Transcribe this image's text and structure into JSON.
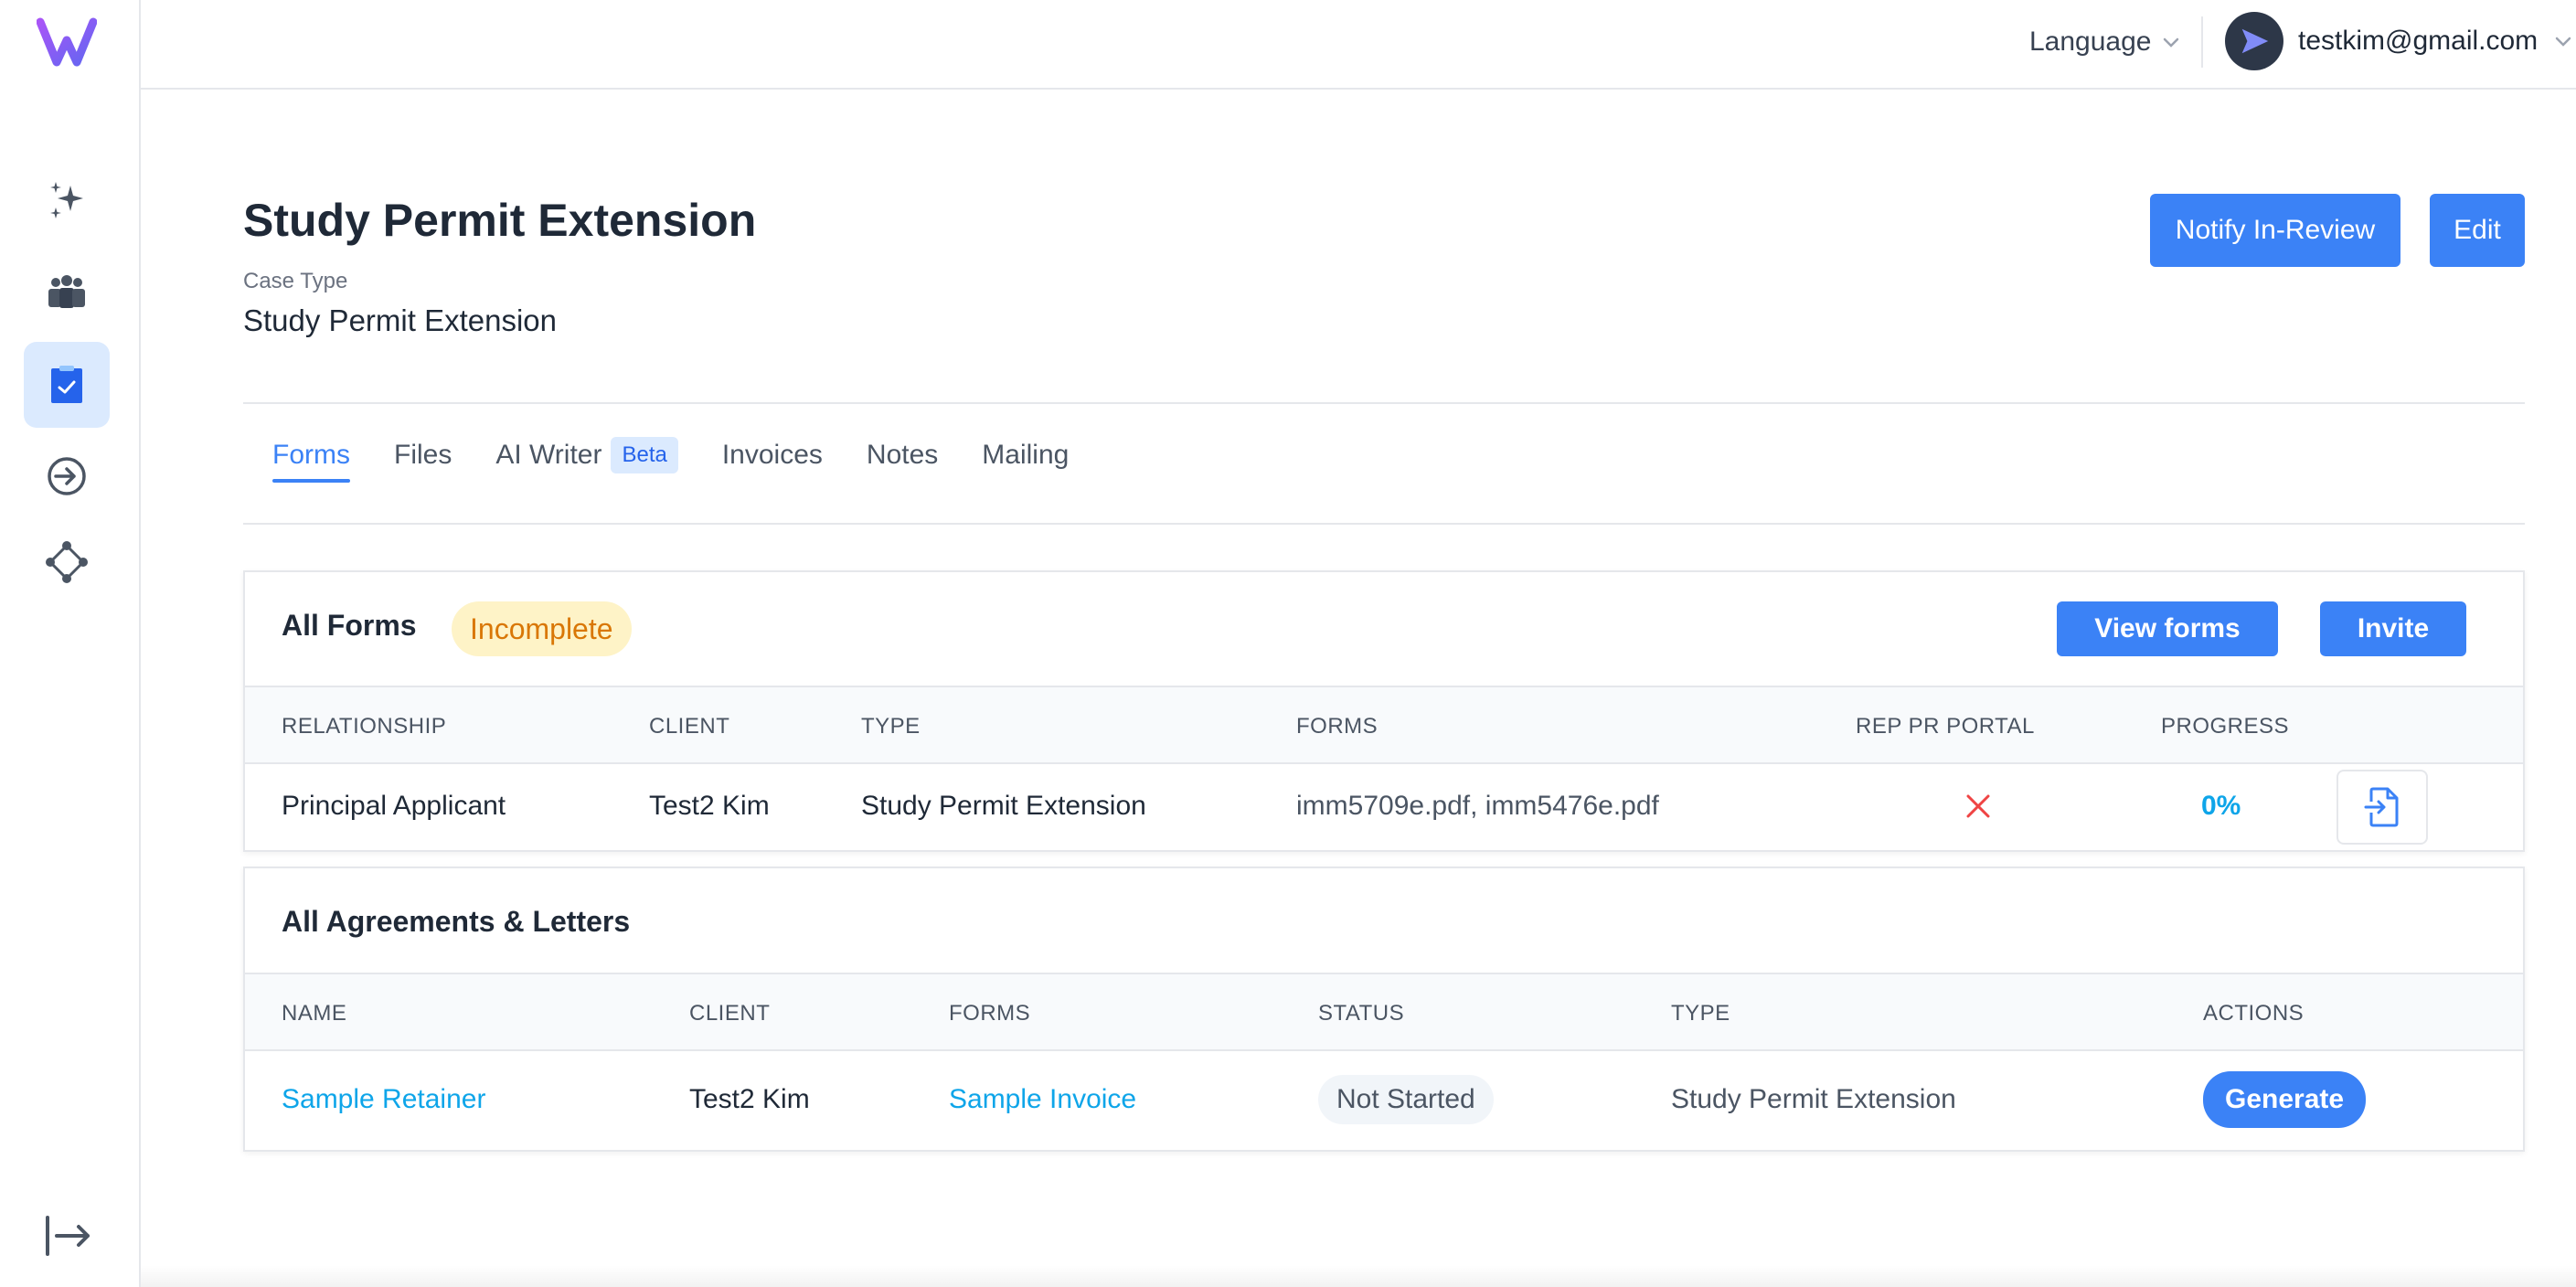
{
  "topbar": {
    "language_label": "Language",
    "user_email": "testkim@gmail.com"
  },
  "header": {
    "title": "Study Permit Extension",
    "case_type_label": "Case Type",
    "case_type_value": "Study Permit Extension",
    "notify_label": "Notify In-Review",
    "edit_label": "Edit"
  },
  "tabs": [
    {
      "label": "Forms",
      "active": true
    },
    {
      "label": "Files"
    },
    {
      "label": "AI Writer",
      "badge": "Beta"
    },
    {
      "label": "Invoices"
    },
    {
      "label": "Notes"
    },
    {
      "label": "Mailing"
    }
  ],
  "forms_card": {
    "title": "All Forms",
    "status_badge": "Incomplete",
    "view_forms_label": "View forms",
    "invite_label": "Invite",
    "columns": [
      "RELATIONSHIP",
      "CLIENT",
      "TYPE",
      "FORMS",
      "REP PR PORTAL",
      "PROGRESS"
    ],
    "rows": [
      {
        "relationship": "Principal Applicant",
        "client": "Test2 Kim",
        "type": "Study Permit Extension",
        "forms": "imm5709e.pdf, imm5476e.pdf",
        "progress": "0%"
      }
    ]
  },
  "agreements_card": {
    "title": "All Agreements & Letters",
    "columns": [
      "NAME",
      "CLIENT",
      "FORMS",
      "STATUS",
      "TYPE",
      "ACTIONS"
    ],
    "rows": [
      {
        "name": "Sample Retainer",
        "client": "Test2 Kim",
        "forms": "Sample Invoice",
        "status": "Not Started",
        "type": "Study Permit Extension",
        "action": "Generate"
      }
    ]
  },
  "colors": {
    "primary": "#3b82f6",
    "link": "#0ea5e9",
    "warning_bg": "#fef3c7",
    "warning_text": "#d97706",
    "danger": "#ef4444"
  }
}
